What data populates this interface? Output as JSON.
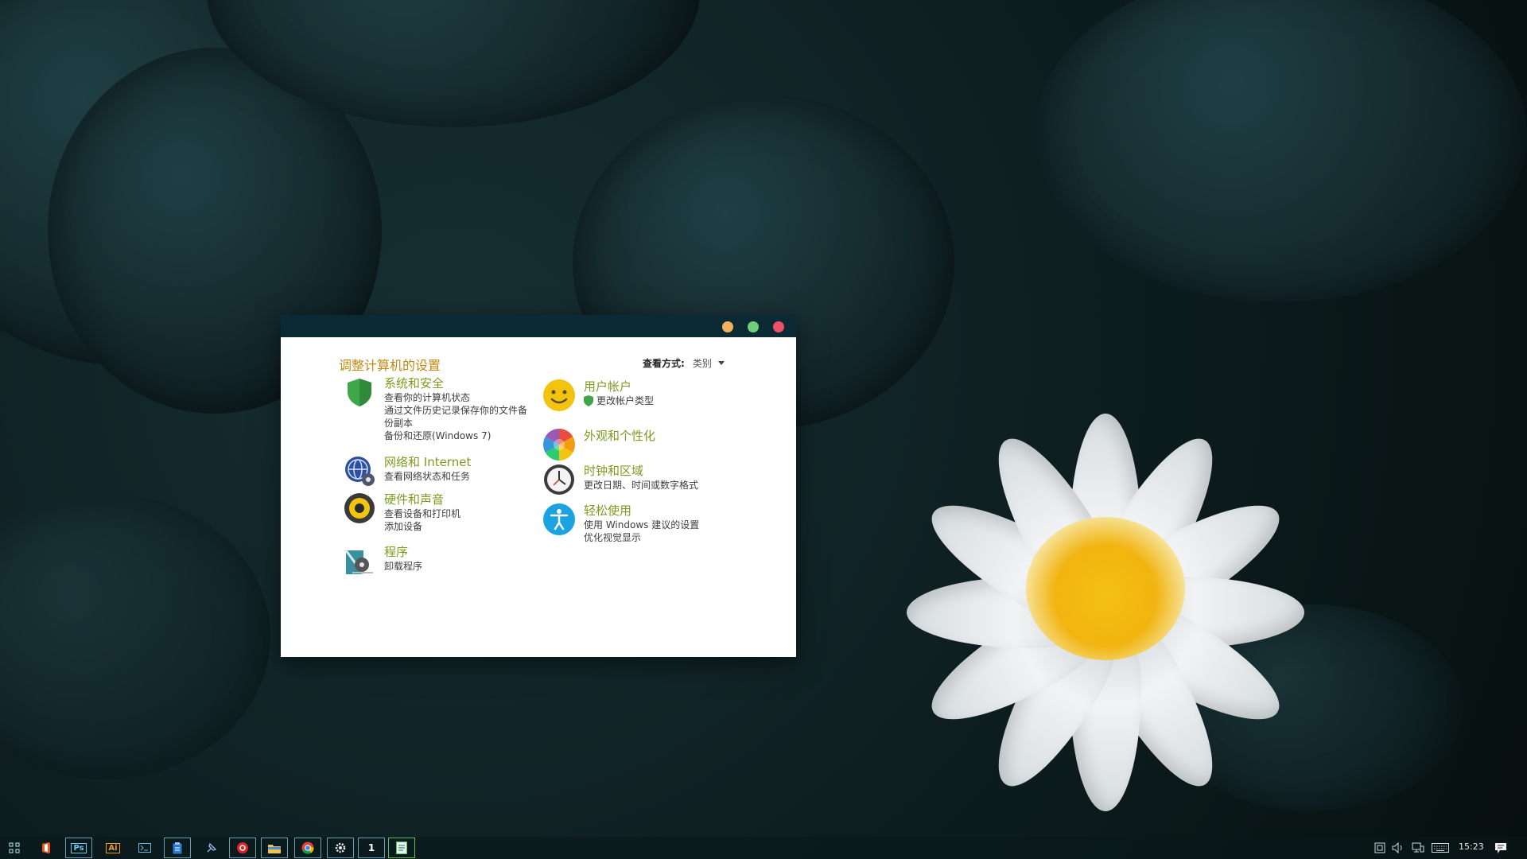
{
  "window": {
    "title_controls": [
      "minimize",
      "maximize",
      "close"
    ],
    "panel_title": "调整计算机的设置",
    "view_by": {
      "label": "查看方式:",
      "value": "类别"
    }
  },
  "categories": {
    "system_security": {
      "title": "系统和安全",
      "icon": "shield-icon",
      "links": [
        "查看你的计算机状态",
        "通过文件历史记录保存你的文件备份副本",
        "备份和还原(Windows 7)"
      ]
    },
    "network_internet": {
      "title": "网络和 Internet",
      "icon": "globe-network-icon",
      "links": [
        "查看网络状态和任务"
      ]
    },
    "hardware_sound": {
      "title": "硬件和声音",
      "icon": "speaker-icon",
      "links": [
        "查看设备和打印机",
        "添加设备"
      ]
    },
    "programs": {
      "title": "程序",
      "icon": "programs-icon",
      "links": [
        "卸载程序"
      ]
    },
    "user_accounts": {
      "title": "用户帐户",
      "icon": "smiley-face-icon",
      "links": [
        "更改帐户类型"
      ]
    },
    "appearance": {
      "title": "外观和个性化",
      "icon": "color-wheel-icon",
      "links": []
    },
    "clock_region": {
      "title": "时钟和区域",
      "icon": "clock-icon",
      "links": [
        "更改日期、时间或数字格式"
      ]
    },
    "ease_of_access": {
      "title": "轻松使用",
      "icon": "accessibility-icon",
      "links": [
        "使用 Windows 建议的设置",
        "优化视觉显示"
      ]
    }
  },
  "taskbar": {
    "apps": [
      "start-grid-icon",
      "office-icon",
      "photoshop-icon",
      "illustrator-icon",
      "terminal-icon",
      "clipboard-icon",
      "pin-icon",
      "music-icon",
      "file-explorer-icon",
      "chrome-icon",
      "settings-icon",
      "number-one-icon",
      "notes-icon"
    ],
    "photoshop_label": "Ps",
    "illustrator_label": "Ai",
    "number_app_label": "1",
    "clock": "15:23"
  },
  "colors": {
    "category_title": "#7c9b1f",
    "panel_title": "#bf8a11",
    "titlebar": "#0c2a33",
    "min": "#f2b160",
    "max": "#6fcf76",
    "close": "#ef4f6a"
  }
}
